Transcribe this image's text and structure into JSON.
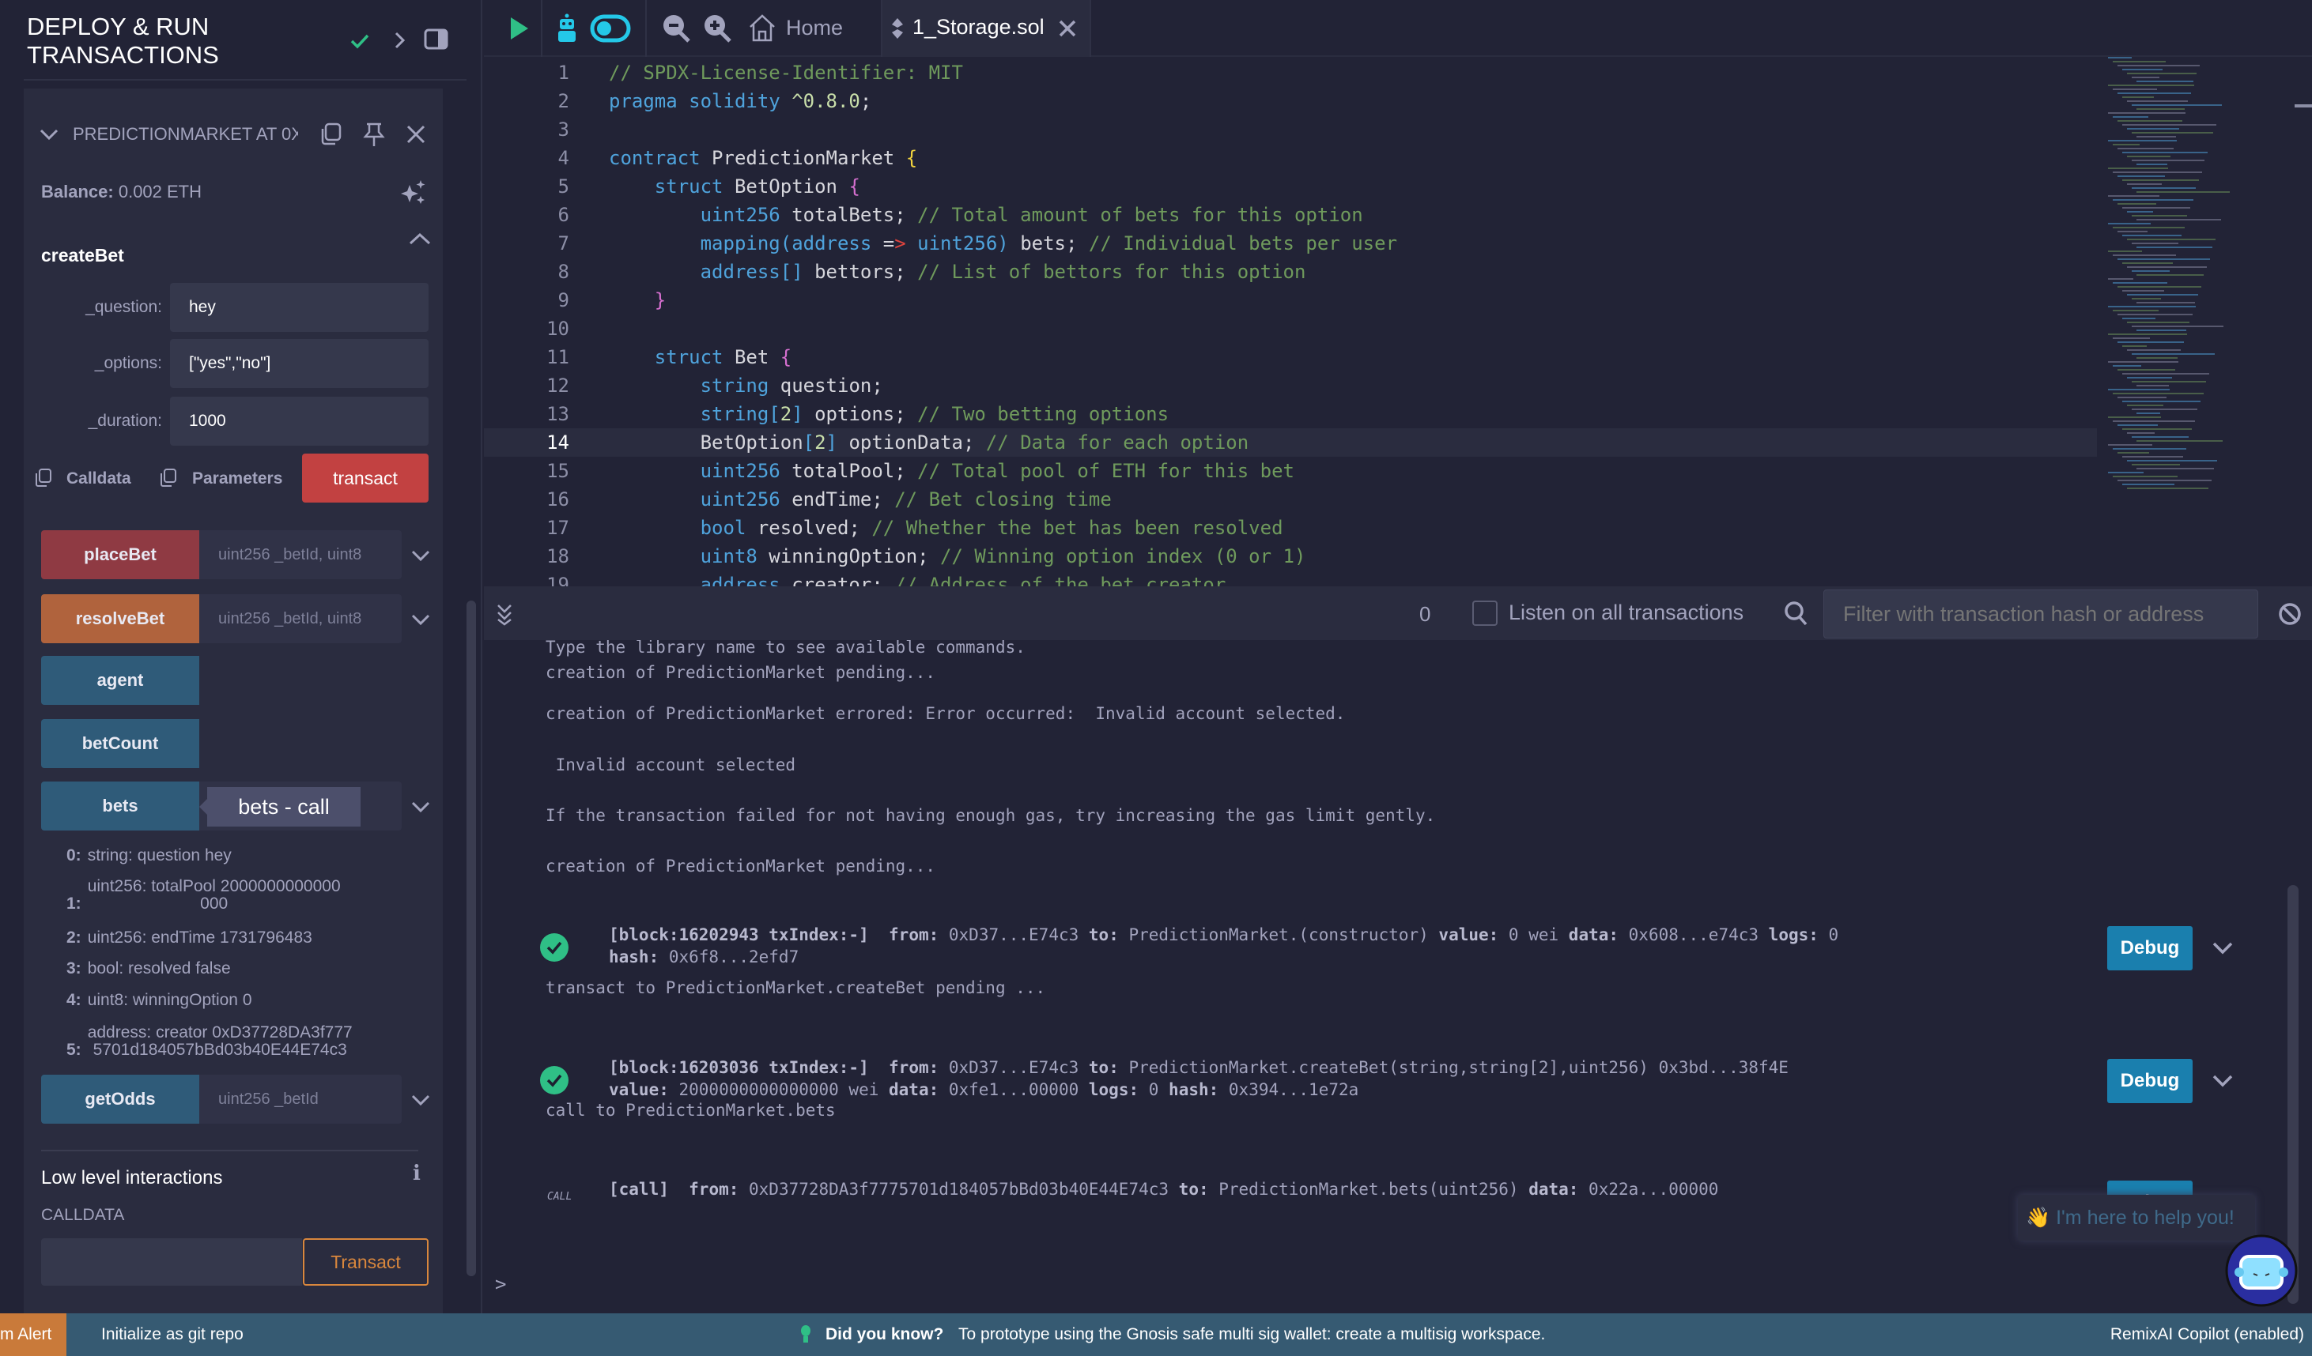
{
  "sidebar": {
    "title": "DEPLOY & RUN TRANSACTIONS",
    "contract_title": "PREDICTIONMARKET AT 0X",
    "balance_label": "Balance:",
    "balance_value": "0.002 ETH",
    "function_name": "createBet",
    "inputs": [
      {
        "label": "_question:",
        "value": "hey"
      },
      {
        "label": "_options:",
        "value": "[\"yes\",\"no\"]"
      },
      {
        "label": "_duration:",
        "value": "1000"
      }
    ],
    "calldata_label": "Calldata",
    "parameters_label": "Parameters",
    "transact_label": "transact",
    "functions": [
      {
        "label": "placeBet",
        "params": "uint256 _betId, uint8",
        "color": "#8f3a43"
      },
      {
        "label": "resolveBet",
        "params": "uint256 _betId, uint8",
        "color": "#b0633d"
      },
      {
        "label": "agent",
        "params": "",
        "color": "#2f5b79"
      },
      {
        "label": "betCount",
        "params": "",
        "color": "#2f5b79"
      },
      {
        "label": "bets",
        "params": "",
        "color": "#2f5b79"
      },
      {
        "label": "getOdds",
        "params": "uint256 _betId",
        "color": "#2f5b79"
      }
    ],
    "tooltip": "bets - call",
    "results": [
      {
        "idx": "0:",
        "text": "string: question hey"
      },
      {
        "idx": "1:",
        "text": "uint256: totalPool 2000000000000\n000"
      },
      {
        "idx": "2:",
        "text": "uint256: endTime 1731796483"
      },
      {
        "idx": "3:",
        "text": "bool: resolved false"
      },
      {
        "idx": "4:",
        "text": "uint8: winningOption 0"
      },
      {
        "idx": "5:",
        "text": "address: creator 0xD37728DA3f777\n5701d184057bBd03b40E44E74c3"
      }
    ],
    "low_level_title": "Low level interactions",
    "calldata_caption": "CALLDATA",
    "calldata_value": "",
    "low_level_transact": "Transact"
  },
  "topbar": {
    "home_label": "Home",
    "tab_label": "1_Storage.sol"
  },
  "editor": {
    "active_line": 14,
    "lines": [
      [
        [
          "// SPDX-License-Identifier: MIT",
          "c"
        ]
      ],
      [
        [
          "pragma solidity ",
          "k"
        ],
        [
          "^0.8.0",
          "n"
        ],
        [
          ";",
          "t"
        ]
      ],
      [],
      [
        [
          "contract ",
          "k"
        ],
        [
          "PredictionMarket ",
          "t"
        ],
        [
          "{",
          "y"
        ]
      ],
      [
        [
          "    struct ",
          "k"
        ],
        [
          "BetOption ",
          "t"
        ],
        [
          "{",
          "p"
        ]
      ],
      [
        [
          "        uint256 ",
          "k"
        ],
        [
          "totalBets; ",
          "t"
        ],
        [
          "// Total amount of bets for this option",
          "c"
        ]
      ],
      [
        [
          "        mapping(address ",
          "k"
        ],
        [
          "=",
          "t"
        ],
        [
          ">",
          "r"
        ],
        [
          " uint256) ",
          "k"
        ],
        [
          "bets; ",
          "t"
        ],
        [
          "// Individual bets per user",
          "c"
        ]
      ],
      [
        [
          "        address[] ",
          "k"
        ],
        [
          "bettors; ",
          "t"
        ],
        [
          "// List of bettors for this option",
          "c"
        ]
      ],
      [
        [
          "    }",
          "p"
        ]
      ],
      [],
      [
        [
          "    struct ",
          "k"
        ],
        [
          "Bet ",
          "t"
        ],
        [
          "{",
          "p"
        ]
      ],
      [
        [
          "        string ",
          "k"
        ],
        [
          "question;",
          "t"
        ]
      ],
      [
        [
          "        string[",
          "k"
        ],
        [
          "2",
          "n"
        ],
        [
          "] ",
          "k"
        ],
        [
          "options; ",
          "t"
        ],
        [
          "// Two betting options",
          "c"
        ]
      ],
      [
        [
          "        BetOption",
          "t"
        ],
        [
          "[",
          "k"
        ],
        [
          "2",
          "n"
        ],
        [
          "] ",
          "k"
        ],
        [
          "optionData; ",
          "t"
        ],
        [
          "// Data for each option",
          "c"
        ]
      ],
      [
        [
          "        uint256 ",
          "k"
        ],
        [
          "totalPool; ",
          "t"
        ],
        [
          "// Total pool of ETH for this bet",
          "c"
        ]
      ],
      [
        [
          "        uint256 ",
          "k"
        ],
        [
          "endTime; ",
          "t"
        ],
        [
          "// Bet closing time",
          "c"
        ]
      ],
      [
        [
          "        bool ",
          "k"
        ],
        [
          "resolved; ",
          "t"
        ],
        [
          "// Whether the bet has been resolved",
          "c"
        ]
      ],
      [
        [
          "        uint8 ",
          "k"
        ],
        [
          "winningOption; ",
          "t"
        ],
        [
          "// Winning option index (0 or 1)",
          "c"
        ]
      ],
      [
        [
          "        address ",
          "k"
        ],
        [
          "creator; ",
          "t"
        ],
        [
          "// Address of the bet creator",
          "c"
        ]
      ]
    ]
  },
  "terminal": {
    "pending_count": "0",
    "listen_label": "Listen on all transactions",
    "listen_checked": false,
    "filter_placeholder": "Filter with transaction hash or address",
    "entries": [
      {
        "type": "text",
        "text": "Type the library name to see available commands."
      },
      {
        "type": "text",
        "text": "creation of PredictionMarket pending..."
      },
      {
        "type": "text",
        "text": "creation of PredictionMarket errored: Error occurred:  Invalid account selected."
      },
      {
        "type": "text",
        "text": " Invalid account selected"
      },
      {
        "type": "text",
        "text": "If the transaction failed for not having enough gas, try increasing the gas limit gently."
      },
      {
        "type": "text",
        "text": "creation of PredictionMarket pending..."
      },
      {
        "type": "tx",
        "icon": "success",
        "debug": "Debug",
        "lines": [
          [
            [
              "[block:16202943 txIndex:-]",
              1
            ],
            [
              "  ",
              0
            ],
            [
              "from:",
              1
            ],
            [
              " 0xD37...E74c3 ",
              0
            ],
            [
              "to:",
              1
            ],
            [
              " PredictionMarket.(constructor) ",
              0
            ],
            [
              "value:",
              1
            ],
            [
              " 0 wei ",
              0
            ],
            [
              "data:",
              1
            ],
            [
              " 0x608...e74c3 ",
              0
            ],
            [
              "logs:",
              1
            ],
            [
              " 0",
              0
            ]
          ],
          [
            [
              "hash:",
              1
            ],
            [
              " 0x6f8...2efd7",
              0
            ]
          ]
        ]
      },
      {
        "type": "text",
        "text": "transact to PredictionMarket.createBet pending ..."
      },
      {
        "type": "tx",
        "icon": "success",
        "debug": "Debug",
        "lines": [
          [
            [
              "[block:16203036 txIndex:-]",
              1
            ],
            [
              "  ",
              0
            ],
            [
              "from:",
              1
            ],
            [
              " 0xD37...E74c3 ",
              0
            ],
            [
              "to:",
              1
            ],
            [
              " PredictionMarket.createBet(string,string[2],uint256) 0x3bd...38f4E",
              0
            ]
          ],
          [
            [
              "value:",
              1
            ],
            [
              " 2000000000000000 wei ",
              0
            ],
            [
              "data:",
              1
            ],
            [
              " 0xfe1...00000 ",
              0
            ],
            [
              "logs:",
              1
            ],
            [
              " 0 ",
              0
            ],
            [
              "hash:",
              1
            ],
            [
              " 0x394...1e72a",
              0
            ]
          ]
        ]
      },
      {
        "type": "text",
        "text": "call to PredictionMarket.bets"
      },
      {
        "type": "call",
        "icon_label": "CALL",
        "debug": "Debug",
        "lines": [
          [
            [
              "[call]",
              1
            ],
            [
              "  ",
              0
            ],
            [
              "from:",
              1
            ],
            [
              " 0xD37728DA3f7775701d184057bBd03b40E44E74c3 ",
              0
            ],
            [
              "to:",
              1
            ],
            [
              " PredictionMarket.bets(uint256) ",
              0
            ],
            [
              "data:",
              1
            ],
            [
              " 0x22a...00000",
              0
            ]
          ]
        ]
      }
    ],
    "prompt": ">",
    "helper_text": "👋 I'm here to help you!"
  },
  "statusbar": {
    "alert_label": "m Alert",
    "git_label": "Initialize as git repo",
    "tip_title": "Did you know?",
    "tip_text": "To prototype using the Gnosis safe multi sig wallet: create a multisig workspace.",
    "copilot_label": "RemixAI Copilot (enabled)"
  },
  "colors": {
    "accent": "#1a7fae",
    "transact": "#c24141",
    "success": "#2fbf86",
    "status_bar": "#365a72"
  }
}
